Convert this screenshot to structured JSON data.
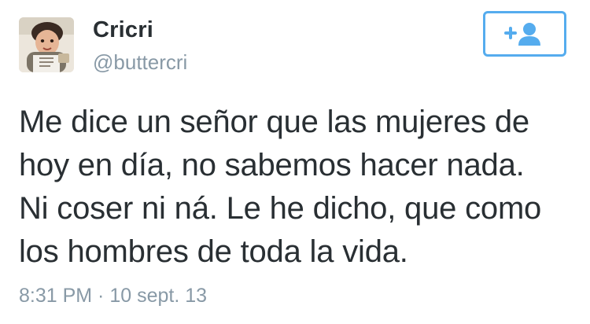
{
  "author": {
    "display_name": "Cricri",
    "handle": "@buttercri",
    "avatar_icon": "profile-photo"
  },
  "follow_button": {
    "icon": "follow-person-plus-icon",
    "accent_color": "#55acee"
  },
  "tweet": {
    "text": "Me dice un señor que las mujeres de\nhoy en día, no sabemos hacer nada.\nNi coser ni ná. Le he dicho, que como\nlos hombres de toda la vida.",
    "timestamp": "8:31 PM · 10 sept. 13"
  },
  "colors": {
    "text": "#292f33",
    "secondary_text": "#8899a6",
    "accent": "#55acee"
  }
}
